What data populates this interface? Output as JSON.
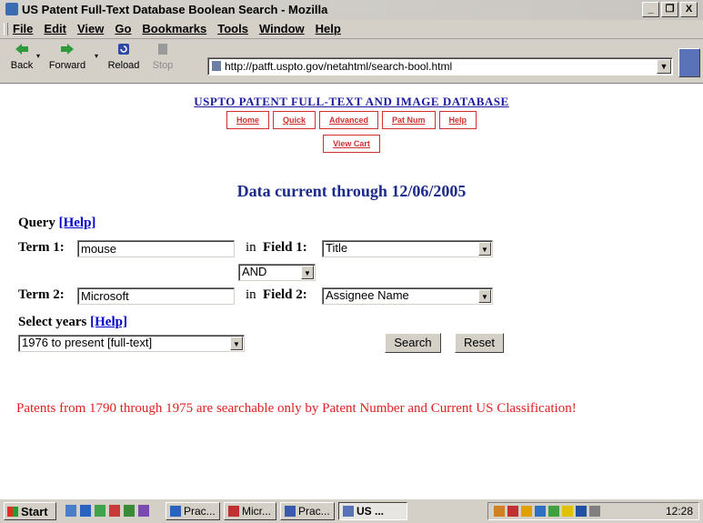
{
  "window": {
    "title": "US Patent Full-Text Database Boolean Search - Mozilla",
    "controls": [
      "_",
      "❒",
      "X"
    ]
  },
  "menu": [
    "File",
    "Edit",
    "View",
    "Go",
    "Bookmarks",
    "Tools",
    "Window",
    "Help"
  ],
  "toolbar": {
    "back": "Back",
    "forward": "Forward",
    "reload": "Reload",
    "stop": "Stop",
    "url": "http://patft.uspto.gov/netahtml/search-bool.html"
  },
  "page": {
    "site_title": "USPTO PATENT FULL-TEXT AND IMAGE DATABASE",
    "nav": [
      "Home",
      "Quick",
      "Advanced",
      "Pat Num",
      "Help"
    ],
    "view_cart": "View Cart",
    "heading": "Data current through 12/06/2005",
    "query_label": "Query",
    "help_link": "[Help]",
    "term1_label": "Term 1:",
    "term1_value": "mouse",
    "in_label": "in",
    "field1_label": "Field 1:",
    "field1_value": "Title",
    "operator_value": "AND",
    "term2_label": "Term 2:",
    "term2_value": "Microsoft",
    "field2_label": "Field 2:",
    "field2_value": "Assignee Name",
    "years_label": "Select years",
    "years_help": "[Help]",
    "years_value": "1976 to present [full-text]",
    "search_button": "Search",
    "reset_button": "Reset",
    "notice": "Patents from 1790 through 1975 are searchable only by Patent Number and Current US Classification!"
  },
  "taskbar": {
    "start": "Start",
    "tasks": [
      "Prac...",
      "Micr...",
      "Prac...",
      "US ..."
    ],
    "clock": "12:28"
  },
  "colors": {
    "link_blue": "#0000cc",
    "heading_navy": "#1c2a8a",
    "nav_red": "#d03030",
    "notice_red": "#e02020",
    "chrome_gray": "#d4d0c8"
  }
}
